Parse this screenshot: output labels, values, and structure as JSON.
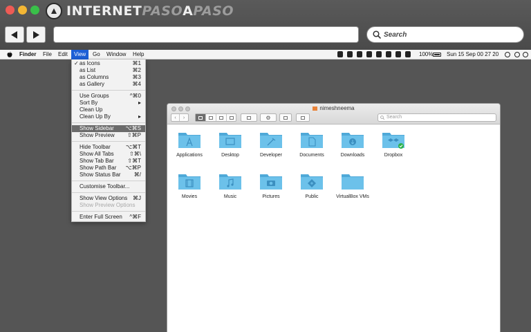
{
  "brand": {
    "name_part1": "INTERNET",
    "name_part2": "PASO",
    "name_part3": "A",
    "name_part4": "PASO"
  },
  "browser": {
    "search_placeholder": "Search"
  },
  "menubar": {
    "items": [
      "Finder",
      "File",
      "Edit",
      "View",
      "Go",
      "Window",
      "Help"
    ],
    "battery": "100%",
    "clock": "Sun 15 Sep  00 27 20"
  },
  "view_menu": {
    "items": [
      {
        "label": "as Icons",
        "shortcut": "⌘1",
        "checked": "✓"
      },
      {
        "label": "as List",
        "shortcut": "⌘2"
      },
      {
        "label": "as Columns",
        "shortcut": "⌘3"
      },
      {
        "label": "as Gallery",
        "shortcut": "⌘4"
      },
      {
        "label": "Use Groups",
        "shortcut": "^⌘0"
      },
      {
        "label": "Sort By",
        "shortcut": "▸"
      },
      {
        "label": "Clean Up",
        "shortcut": ""
      },
      {
        "label": "Clean Up By",
        "shortcut": "▸"
      },
      {
        "label": "Show Sidebar",
        "shortcut": "⌥⌘S"
      },
      {
        "label": "Show Preview",
        "shortcut": "⇧⌘P"
      },
      {
        "label": "Hide Toolbar",
        "shortcut": "⌥⌘T"
      },
      {
        "label": "Show All Tabs",
        "shortcut": "⇧⌘\\"
      },
      {
        "label": "Show Tab Bar",
        "shortcut": "⇧⌘T"
      },
      {
        "label": "Show Path Bar",
        "shortcut": "⌥⌘P"
      },
      {
        "label": "Show Status Bar",
        "shortcut": "⌘/"
      },
      {
        "label": "Customise Toolbar...",
        "shortcut": ""
      },
      {
        "label": "Show View Options",
        "shortcut": "⌘J"
      },
      {
        "label": "Show Preview Options",
        "shortcut": ""
      },
      {
        "label": "Enter Full Screen",
        "shortcut": "^⌘F"
      }
    ]
  },
  "finder": {
    "title": "nimeshneema",
    "search_placeholder": "Search",
    "folders": [
      "Applications",
      "Desktop",
      "Developer",
      "Documents",
      "Downloads",
      "Dropbox",
      "Movies",
      "Music",
      "Pictures",
      "Public",
      "VirtualBox VMs"
    ]
  },
  "colors": {
    "folder": "#6cc1ea",
    "folder_dark": "#4fa9d8",
    "menu_highlight": "#6b6b6b",
    "menubar_active": "#1d5fd6"
  }
}
